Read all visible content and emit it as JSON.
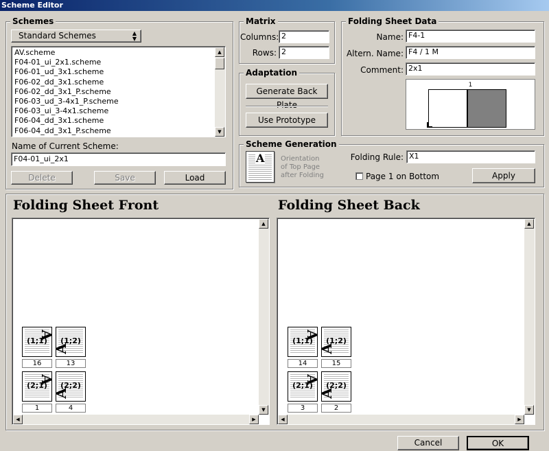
{
  "window": {
    "title": "Scheme Editor"
  },
  "schemes": {
    "title": "Schemes",
    "dropdown_value": "Standard Schemes",
    "list": [
      "AV.scheme",
      "F04-01_ui_2x1.scheme",
      "F06-01_ud_3x1.scheme",
      "F06-02_dd_3x1.scheme",
      "F06-02_dd_3x1_P.scheme",
      "F06-03_ud_3-4x1_P.scheme",
      "F06-03_ui_3-4x1.scheme",
      "F06-04_dd_3x1.scheme",
      "F06-04_dd_3x1_P.scheme"
    ],
    "current_label": "Name of Current Scheme:",
    "current_value": "F04-01_ui_2x1",
    "delete_label": "Delete",
    "save_label": "Save",
    "load_label": "Load"
  },
  "matrix": {
    "title": "Matrix",
    "columns_label": "Columns:",
    "columns_value": "2",
    "rows_label": "Rows:",
    "rows_value": "2"
  },
  "adaptation": {
    "title": "Adaptation",
    "generate_label": "Generate Back Plate",
    "prototype_label": "Use Prototype"
  },
  "sheet_data": {
    "title": "Folding Sheet Data",
    "name_label": "Name:",
    "name_value": "F4-1",
    "altern_label": "Altern. Name:",
    "altern_value": "F4 / 1 M",
    "comment_label": "Comment:",
    "comment_value": "2x1",
    "preview_number": "1"
  },
  "scheme_generation": {
    "title": "Scheme Generation",
    "orientation_line1": "Orientation",
    "orientation_line2": "of Top Page",
    "orientation_line3": "after Folding",
    "rule_label": "Folding Rule:",
    "rule_value": "X1",
    "page1_label": "Page 1 on Bottom",
    "apply_label": "Apply"
  },
  "front": {
    "title": "Folding Sheet Front",
    "tiles": [
      {
        "coord": "(1;1)",
        "page": "16"
      },
      {
        "coord": "(1;2)",
        "page": "13"
      },
      {
        "coord": "(2;1)",
        "page": "1"
      },
      {
        "coord": "(2;2)",
        "page": "4"
      }
    ]
  },
  "back": {
    "title": "Folding Sheet Back",
    "tiles": [
      {
        "coord": "(1;1)",
        "page": "14"
      },
      {
        "coord": "(1;2)",
        "page": "15"
      },
      {
        "coord": "(2;1)",
        "page": "3"
      },
      {
        "coord": "(2;2)",
        "page": "2"
      }
    ]
  },
  "footer": {
    "cancel_label": "Cancel",
    "ok_label": "OK"
  },
  "colors": {
    "titlebar": "#0a246a",
    "face": "#d4d0c8",
    "dark_panel": "#808080"
  }
}
